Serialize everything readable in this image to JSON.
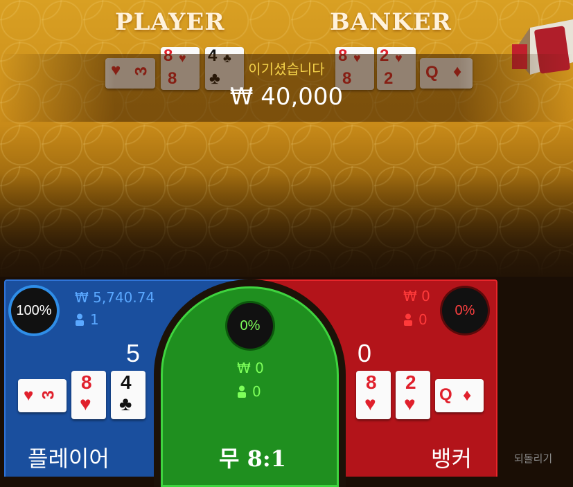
{
  "table": {
    "player_title": "PLAYER",
    "banker_title": "BANKER",
    "player_cards": [
      {
        "rank": "3",
        "suit": "♥",
        "color": "red"
      },
      {
        "rank": "8",
        "suit": "♥",
        "color": "red"
      },
      {
        "rank": "4",
        "suit": "♣",
        "color": "black"
      }
    ],
    "banker_cards": [
      {
        "rank": "8",
        "suit": "♥",
        "color": "red"
      },
      {
        "rank": "2",
        "suit": "♥",
        "color": "red"
      },
      {
        "rank": "Q",
        "suit": "♦",
        "color": "red"
      }
    ]
  },
  "win": {
    "message": "이기셨습니다",
    "amount": "₩ 40,000"
  },
  "bet_panels": {
    "player": {
      "percent": "100%",
      "percent_value": 1.0,
      "total_bet": "₩ 5,740.74",
      "bettors": "1",
      "score": "5",
      "label": "플레이어",
      "cards": [
        "3♥",
        "8♥",
        "4♣"
      ]
    },
    "tie": {
      "percent": "0%",
      "percent_value": 0,
      "total_bet": "₩ 0",
      "bettors": "0",
      "label": "무 8:1"
    },
    "banker": {
      "percent": "0%",
      "percent_value": 0,
      "total_bet": "₩ 0",
      "bettors": "0",
      "score": "0",
      "label": "뱅커",
      "cards": [
        "8♥",
        "2♥",
        "Q♦"
      ]
    }
  },
  "controls": {
    "undo_label": "되돌리기"
  },
  "colors": {
    "player": "#1a4f9e",
    "tie": "#1f8f1f",
    "banker": "#b3141a",
    "gold_text": "#f4d24a"
  }
}
